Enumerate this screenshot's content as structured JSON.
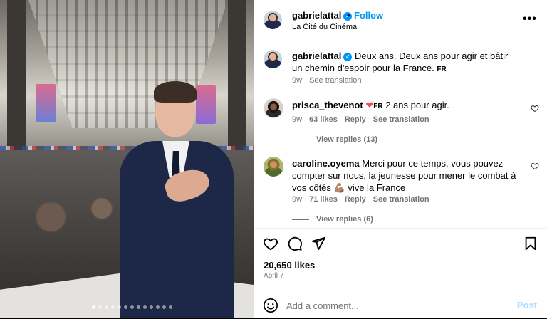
{
  "post": {
    "author": "gabrielattal",
    "follow_label": "Follow",
    "separator": "•",
    "location": "La Cité du Cinéma",
    "caption": "Deux ans. Deux ans pour agir et bâtir un chemin d'espoir pour la France.",
    "caption_lang": "FR",
    "caption_age": "9w",
    "see_translation": "See translation",
    "more_icon": "more-horizontal-icon",
    "likes": "20,650 likes",
    "date": "April 7",
    "carousel": {
      "total": 13,
      "active": 0
    }
  },
  "comments": [
    {
      "user": "prisca_thevenot",
      "emoji": "❤️",
      "lang": "FR",
      "text": "2 ans pour agir.",
      "age": "9w",
      "likes": "63 likes",
      "reply": "Reply",
      "see_translation": "See translation",
      "view_replies": "View replies (13)"
    },
    {
      "user": "caroline.oyema",
      "text": "Merci pour ce temps, vous pouvez compter sur nous, la jeunesse pour mener le combat à vos côtés 💪🏽 vive la France",
      "age": "9w",
      "likes": "71 likes",
      "reply": "Reply",
      "see_translation": "See translation",
      "view_replies": "View replies (6)"
    }
  ],
  "composer": {
    "placeholder": "Add a comment...",
    "post_label": "Post",
    "emoji_icon": "emoji-smile-icon"
  },
  "colors": {
    "accent": "#0095f6",
    "muted": "#737373",
    "post_disabled": "#b3dbff"
  }
}
